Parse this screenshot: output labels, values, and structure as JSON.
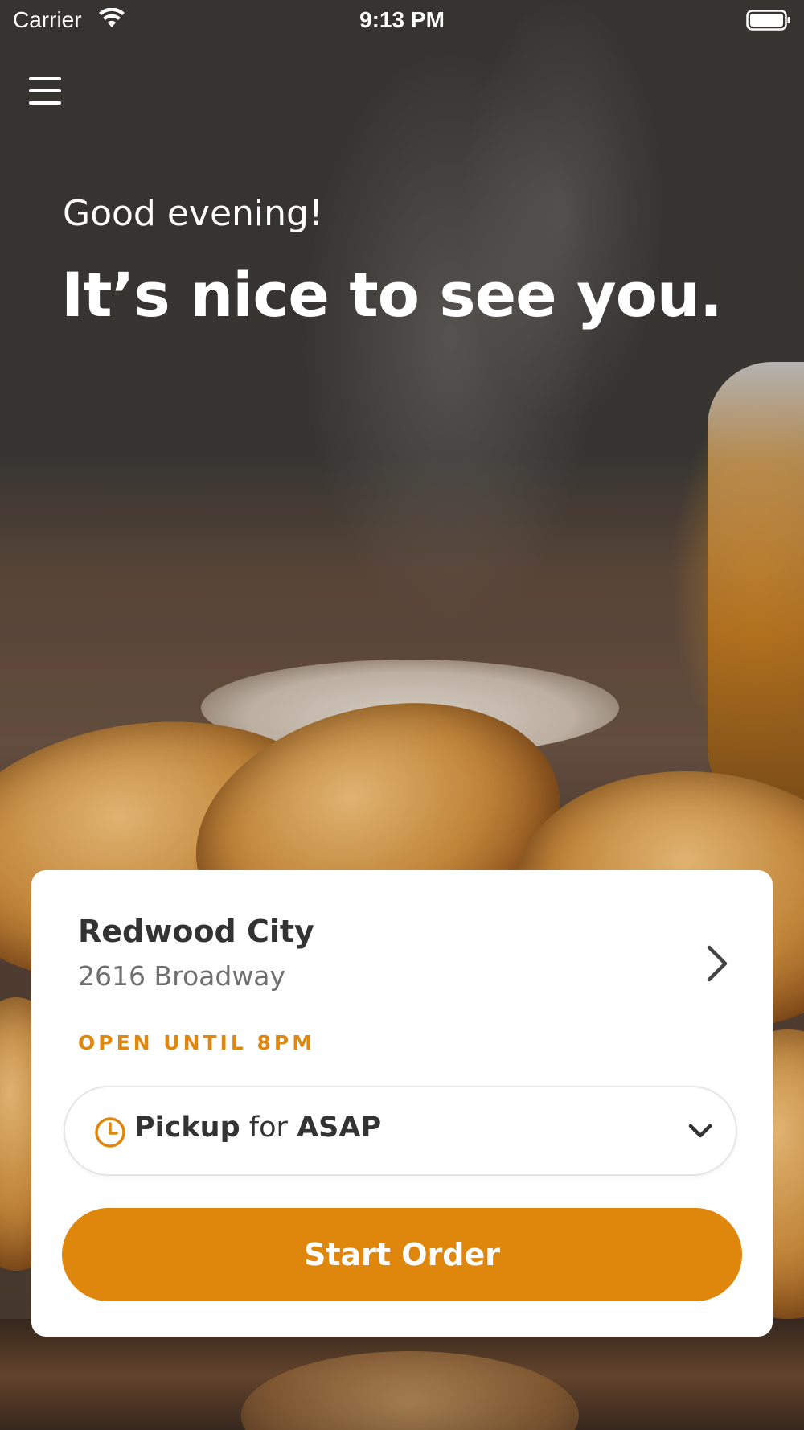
{
  "status_bar": {
    "carrier": "Carrier",
    "time": "9:13 PM",
    "wifi_icon": "wifi-icon",
    "battery_icon": "battery-icon"
  },
  "header": {
    "menu_icon": "hamburger-menu-icon"
  },
  "hero": {
    "greeting": "Good evening!",
    "headline": "It’s nice to see you."
  },
  "location_card": {
    "name": "Redwood City",
    "address": "2616 Broadway",
    "hours": "OPEN UNTIL 8PM",
    "chevron_icon": "chevron-right-icon"
  },
  "order_mode": {
    "icon": "clock-icon",
    "mode": "Pickup",
    "connector": "for",
    "time": "ASAP",
    "dropdown_icon": "chevron-down-icon"
  },
  "actions": {
    "start_order": "Start Order"
  },
  "colors": {
    "accent": "#df860c",
    "card_bg": "#ffffff",
    "text_primary": "#333333",
    "text_secondary": "#6f6f6f"
  }
}
